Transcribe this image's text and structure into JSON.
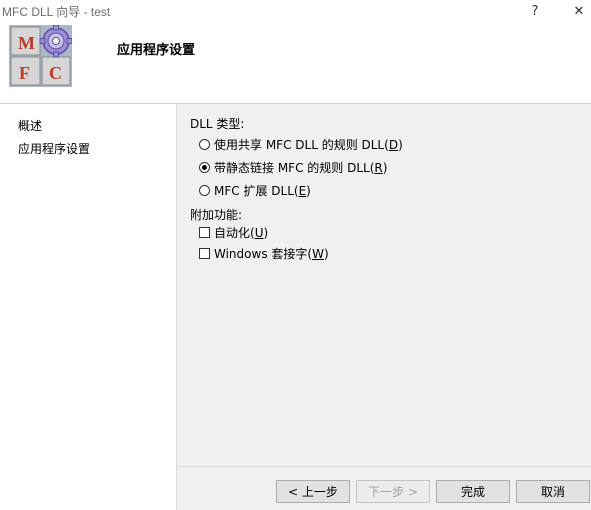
{
  "window": {
    "title": "MFC DLL 向导 - test",
    "help_label": "?",
    "close_label": "✕"
  },
  "header": {
    "title": "应用程序设置",
    "logo_letters": [
      "M",
      "F",
      "C"
    ]
  },
  "nav": {
    "items": [
      {
        "label": "概述"
      },
      {
        "label": "应用程序设置"
      }
    ]
  },
  "dll_type": {
    "label": "DLL 类型:",
    "options": [
      {
        "label": "使用共享 MFC DLL 的规则 DLL(",
        "mnemonic": "D",
        "tail": ")",
        "checked": false
      },
      {
        "label": "带静态链接 MFC 的规则 DLL(",
        "mnemonic": "R",
        "tail": ")",
        "checked": true
      },
      {
        "label": "MFC 扩展 DLL(",
        "mnemonic": "E",
        "tail": ")",
        "checked": false
      }
    ]
  },
  "features": {
    "label": "附加功能:",
    "options": [
      {
        "label": "自动化(",
        "mnemonic": "U",
        "tail": ")",
        "checked": false
      },
      {
        "label": "Windows 套接字(",
        "mnemonic": "W",
        "tail": ")",
        "checked": false
      }
    ]
  },
  "buttons": {
    "prev": "< 上一步",
    "next": "下一步 >",
    "finish": "完成",
    "cancel": "取消"
  },
  "colors": {
    "logo_red": "#c0392b",
    "logo_gray": "#c8c8c8",
    "logo_blue": "#3a6fb5",
    "gear_purple": "#8a7fc8"
  }
}
